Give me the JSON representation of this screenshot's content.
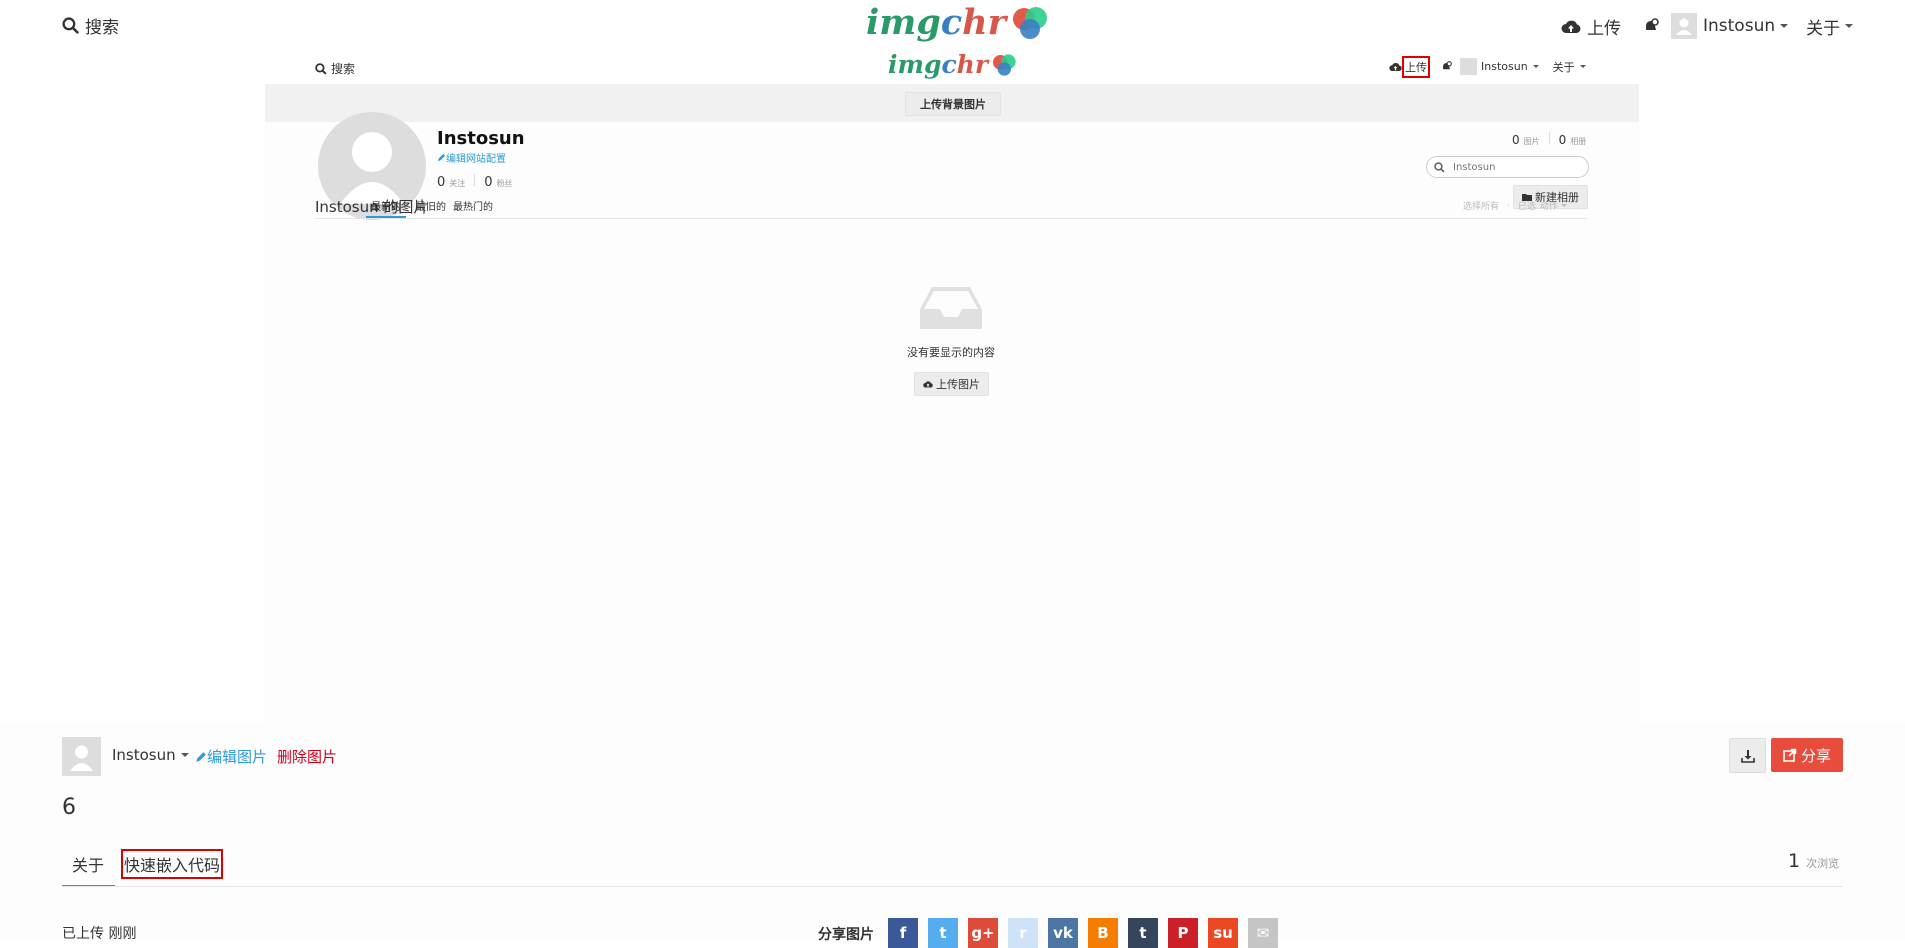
{
  "header": {
    "search_label": "搜索",
    "upload_label": "上传",
    "username": "Instosun",
    "about_label": "关于",
    "logo_text": "imgchr"
  },
  "embedded": {
    "search_label": "搜索",
    "upload_label": "上传",
    "username": "Instosun",
    "about_label": "关于",
    "logo_text": "imgchr",
    "upload_bg_label": "上传背景图片",
    "profile_name": "Instosun",
    "edit_site_label": "编辑网站配置",
    "following_count": "0",
    "following_label": "关注",
    "followers_count": "0",
    "followers_label": "粉丝",
    "images_count": "0",
    "images_label": "图片",
    "albums_count": "0",
    "albums_label": "相册",
    "search_placeholder": "Instosun",
    "new_album_label": "新建相册",
    "gallery_title": "Instosun 的图片",
    "tabs": [
      "最新的",
      "最旧的",
      "最热门的"
    ],
    "select_all_label": "选择所有",
    "selected_label": "已选",
    "action_label": "动作",
    "empty_text": "没有要显示的内容",
    "upload_image_label": "上传图片"
  },
  "image_page": {
    "owner": "Instosun",
    "edit_label": "编辑图片",
    "delete_label": "删除图片",
    "share_label": "分享",
    "image_title": "6",
    "tabs": [
      "关于",
      "快速嵌入代码"
    ],
    "views_count": "1",
    "views_label": "次浏览",
    "uploaded_label": "已上传 刚刚",
    "share_image_label": "分享图片"
  },
  "social_icons": [
    {
      "name": "facebook-icon",
      "glyph": "f",
      "color": "#3b5998"
    },
    {
      "name": "twitter-icon",
      "glyph": "t",
      "color": "#55acee"
    },
    {
      "name": "google-plus-icon",
      "glyph": "g+",
      "color": "#dd4b39"
    },
    {
      "name": "reddit-icon",
      "glyph": "r",
      "color": "#cee3f8"
    },
    {
      "name": "vk-icon",
      "glyph": "vk",
      "color": "#4c75a3"
    },
    {
      "name": "blogger-icon",
      "glyph": "B",
      "color": "#f57d00"
    },
    {
      "name": "tumblr-icon",
      "glyph": "t",
      "color": "#35465c"
    },
    {
      "name": "pinterest-icon",
      "glyph": "P",
      "color": "#cb2027"
    },
    {
      "name": "stumbleupon-icon",
      "glyph": "su",
      "color": "#eb4924"
    },
    {
      "name": "email-icon",
      "glyph": "✉",
      "color": "#c5c5c5"
    }
  ],
  "colors": {
    "accent": "#2d9bd8",
    "danger": "#e74c3c",
    "delete_text": "#d0021b"
  }
}
